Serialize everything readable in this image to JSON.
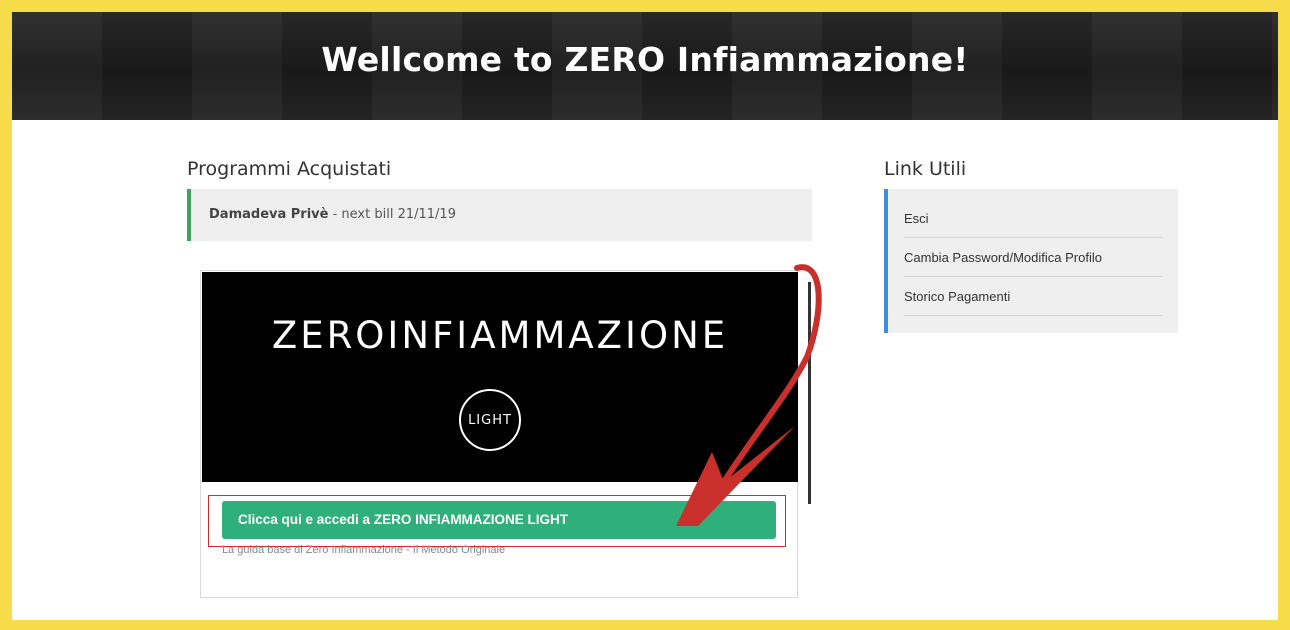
{
  "header": {
    "title": "Wellcome to ZERO Infiammazione!"
  },
  "programs": {
    "heading": "Programmi Acquistati",
    "subscription": {
      "name": "Damadeva Privè",
      "suffix": " - next bill 21/11/19"
    },
    "card": {
      "banner_title": "ZEROINFIAMMAZIONE",
      "badge": "LIGHT",
      "cta": "Clicca qui e accedi a ZERO INFIAMMAZIONE LIGHT",
      "description": "La guida base di Zero Infiammazione - Il Metodo Originale"
    }
  },
  "sidebar": {
    "heading": "Link Utili",
    "links": [
      "Esci",
      "Cambia Password/Modifica Profilo",
      "Storico Pagamenti"
    ]
  },
  "colors": {
    "frame": "#f7dc4a",
    "cta": "#2fb07a",
    "accent_green": "#3da35d",
    "accent_blue": "#3b8fe0",
    "annotation": "#c9302c"
  }
}
